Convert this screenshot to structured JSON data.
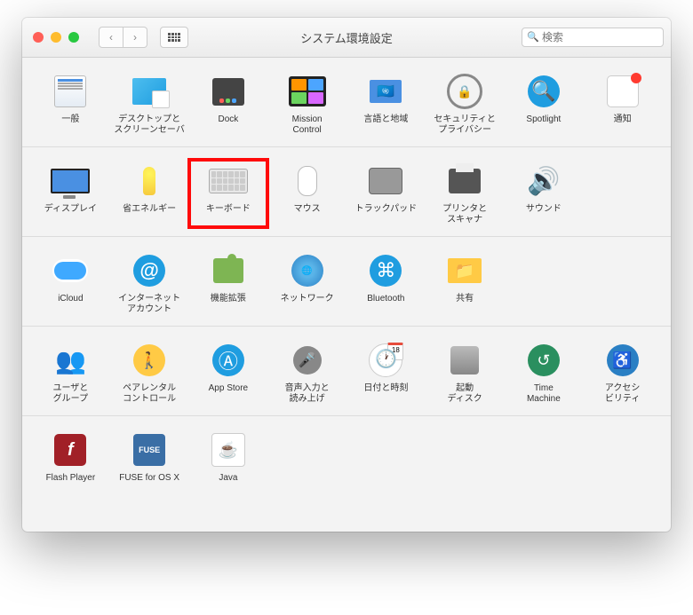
{
  "window": {
    "title": "システム環境設定",
    "search_placeholder": "検索"
  },
  "sections": [
    {
      "items": [
        {
          "id": "general",
          "label": "一般"
        },
        {
          "id": "desktop",
          "label": "デスクトップと\nスクリーンセーバ"
        },
        {
          "id": "dock",
          "label": "Dock"
        },
        {
          "id": "mission",
          "label": "Mission\nControl"
        },
        {
          "id": "language",
          "label": "言語と地域"
        },
        {
          "id": "security",
          "label": "セキュリティと\nプライバシー"
        },
        {
          "id": "spotlight",
          "label": "Spotlight"
        },
        {
          "id": "notifications",
          "label": "通知"
        }
      ]
    },
    {
      "items": [
        {
          "id": "displays",
          "label": "ディスプレイ"
        },
        {
          "id": "energy",
          "label": "省エネルギー"
        },
        {
          "id": "keyboard",
          "label": "キーボード",
          "highlighted": true
        },
        {
          "id": "mouse",
          "label": "マウス"
        },
        {
          "id": "trackpad",
          "label": "トラックパッド"
        },
        {
          "id": "printers",
          "label": "プリンタと\nスキャナ"
        },
        {
          "id": "sound",
          "label": "サウンド"
        }
      ]
    },
    {
      "items": [
        {
          "id": "icloud",
          "label": "iCloud"
        },
        {
          "id": "internet",
          "label": "インターネット\nアカウント"
        },
        {
          "id": "extensions",
          "label": "機能拡張"
        },
        {
          "id": "network",
          "label": "ネットワーク"
        },
        {
          "id": "bluetooth",
          "label": "Bluetooth"
        },
        {
          "id": "sharing",
          "label": "共有"
        }
      ]
    },
    {
      "items": [
        {
          "id": "users",
          "label": "ユーザと\nグループ"
        },
        {
          "id": "parental",
          "label": "ペアレンタル\nコントロール"
        },
        {
          "id": "appstore",
          "label": "App Store"
        },
        {
          "id": "dictation",
          "label": "音声入力と\n読み上げ"
        },
        {
          "id": "datetime",
          "label": "日付と時刻"
        },
        {
          "id": "startupdisk",
          "label": "起動\nディスク"
        },
        {
          "id": "timemachine",
          "label": "Time\nMachine"
        },
        {
          "id": "accessibility",
          "label": "アクセシ\nビリティ"
        }
      ]
    },
    {
      "items": [
        {
          "id": "flash",
          "label": "Flash Player"
        },
        {
          "id": "fuse",
          "label": "FUSE for OS X"
        },
        {
          "id": "java",
          "label": "Java"
        }
      ]
    }
  ]
}
